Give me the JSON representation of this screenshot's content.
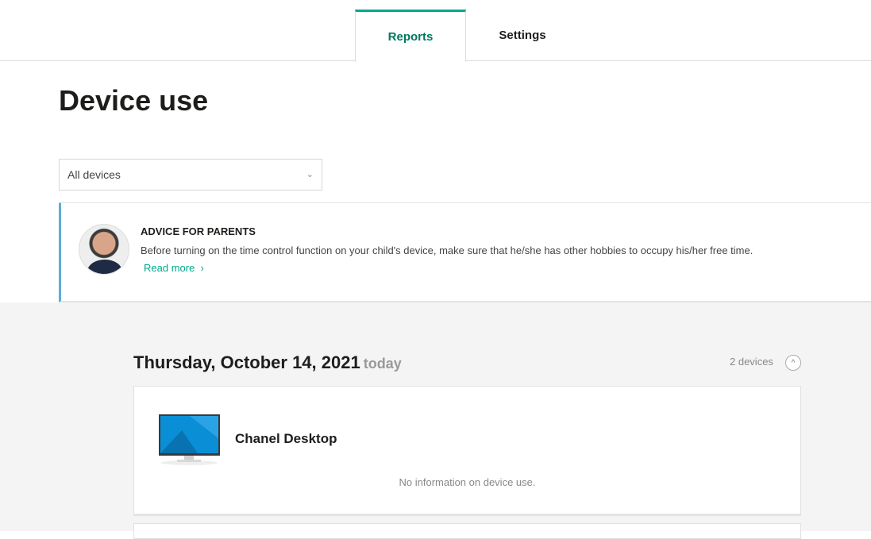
{
  "tabs": {
    "reports": "Reports",
    "settings": "Settings"
  },
  "page_title": "Device use",
  "device_filter": {
    "selected": "All devices"
  },
  "advice": {
    "title": "ADVICE FOR PARENTS",
    "text": "Before turning on the time control function on your child's device, make sure that he/she has other hobbies to occupy his/her free time.",
    "read_more": "Read more"
  },
  "day": {
    "date": "Thursday, October 14, 2021",
    "today": "today",
    "device_count": "2 devices"
  },
  "devices": [
    {
      "name": "Chanel Desktop",
      "status": "No information on device use."
    }
  ],
  "colors": {
    "accent": "#00a88e",
    "advice_border": "#5aaedc"
  }
}
